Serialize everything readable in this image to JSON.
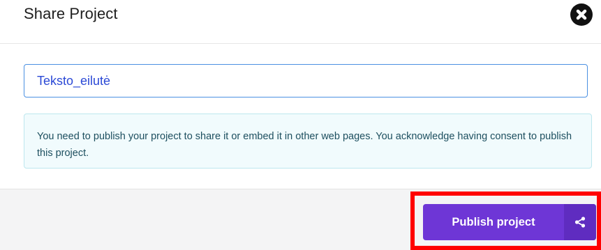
{
  "dialog": {
    "title": "Share Project",
    "close_icon": "close-circle-icon"
  },
  "project_name": {
    "value": "Teksto_eilutė"
  },
  "notice": {
    "text": "You need to publish your project to share it or embed it in other web pages. You acknowledge having consent to publish this project."
  },
  "footer": {
    "publish_label": "Publish project",
    "share_icon": "share-icon"
  },
  "colors": {
    "accent": "#6e36d6",
    "accent_dark": "#5f2cc0",
    "highlight": "#ff0000",
    "notice_bg": "#f1fbfd",
    "notice_border": "#bde7ee",
    "input_border": "#4a90e2"
  }
}
